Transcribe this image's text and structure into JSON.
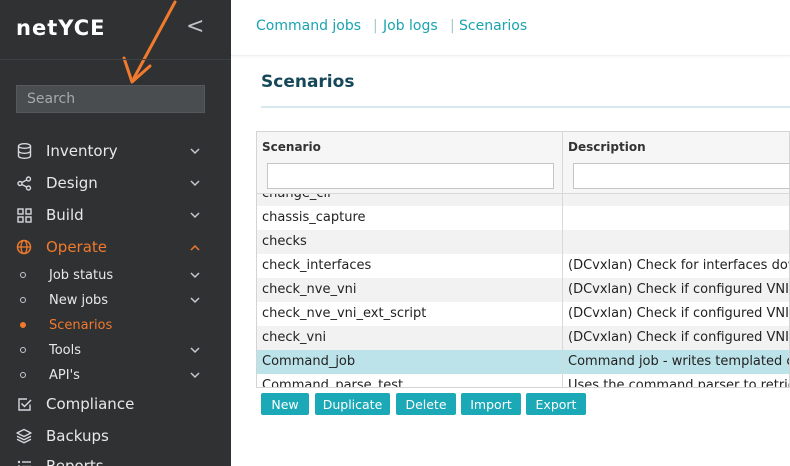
{
  "sidebar": {
    "logo": "netYCE",
    "collapse": "<",
    "search_placeholder": "Search",
    "items": [
      {
        "label": "Inventory",
        "chevron": "⌄"
      },
      {
        "label": "Design",
        "chevron": "⌄"
      },
      {
        "label": "Build",
        "chevron": "⌄"
      },
      {
        "label": "Operate",
        "chevron": "⌃"
      },
      {
        "label": "Compliance"
      },
      {
        "label": "Backups"
      },
      {
        "label": "Reports"
      }
    ],
    "sub_items": [
      {
        "label": "Job status",
        "chevron": "⌄"
      },
      {
        "label": "New jobs",
        "chevron": "⌄"
      },
      {
        "label": "Scenarios"
      },
      {
        "label": "Tools",
        "chevron": "⌄"
      },
      {
        "label": "API's",
        "chevron": "⌄"
      }
    ],
    "accent_color": "#f07a2d"
  },
  "breadcrumbs": [
    "Command jobs",
    "Job logs",
    "Scenarios"
  ],
  "breadcrumb_sep": "|",
  "page_title": "Scenarios",
  "grid": {
    "columns": [
      "Scenario",
      "Description"
    ],
    "rows": [
      {
        "scenario": "change_cli",
        "description": ""
      },
      {
        "scenario": "chassis_capture",
        "description": ""
      },
      {
        "scenario": "checks",
        "description": ""
      },
      {
        "scenario": "check_interfaces",
        "description": "(DCvxlan) Check for interfaces down"
      },
      {
        "scenario": "check_nve_vni",
        "description": "(DCvxlan) Check if configured VNI's o"
      },
      {
        "scenario": "check_nve_vni_ext_script",
        "description": "(DCvxlan) Check if configured VNI's o"
      },
      {
        "scenario": "check_vni",
        "description": "(DCvxlan) Check if configured VNI's o"
      },
      {
        "scenario": "Command_job",
        "description": "Command job - writes templated co"
      },
      {
        "scenario": "Command_parse_test",
        "description": "Uses the command parser to retrieve"
      }
    ],
    "selected_row": "Command_job"
  },
  "buttons": [
    "New",
    "Duplicate",
    "Delete",
    "Import",
    "Export"
  ],
  "colors": {
    "sidebar_bg": "#2f3133",
    "link": "#1aa3b0",
    "button": "#1ba9b8",
    "title": "#16485a",
    "selected_row": "#bde3ea"
  }
}
